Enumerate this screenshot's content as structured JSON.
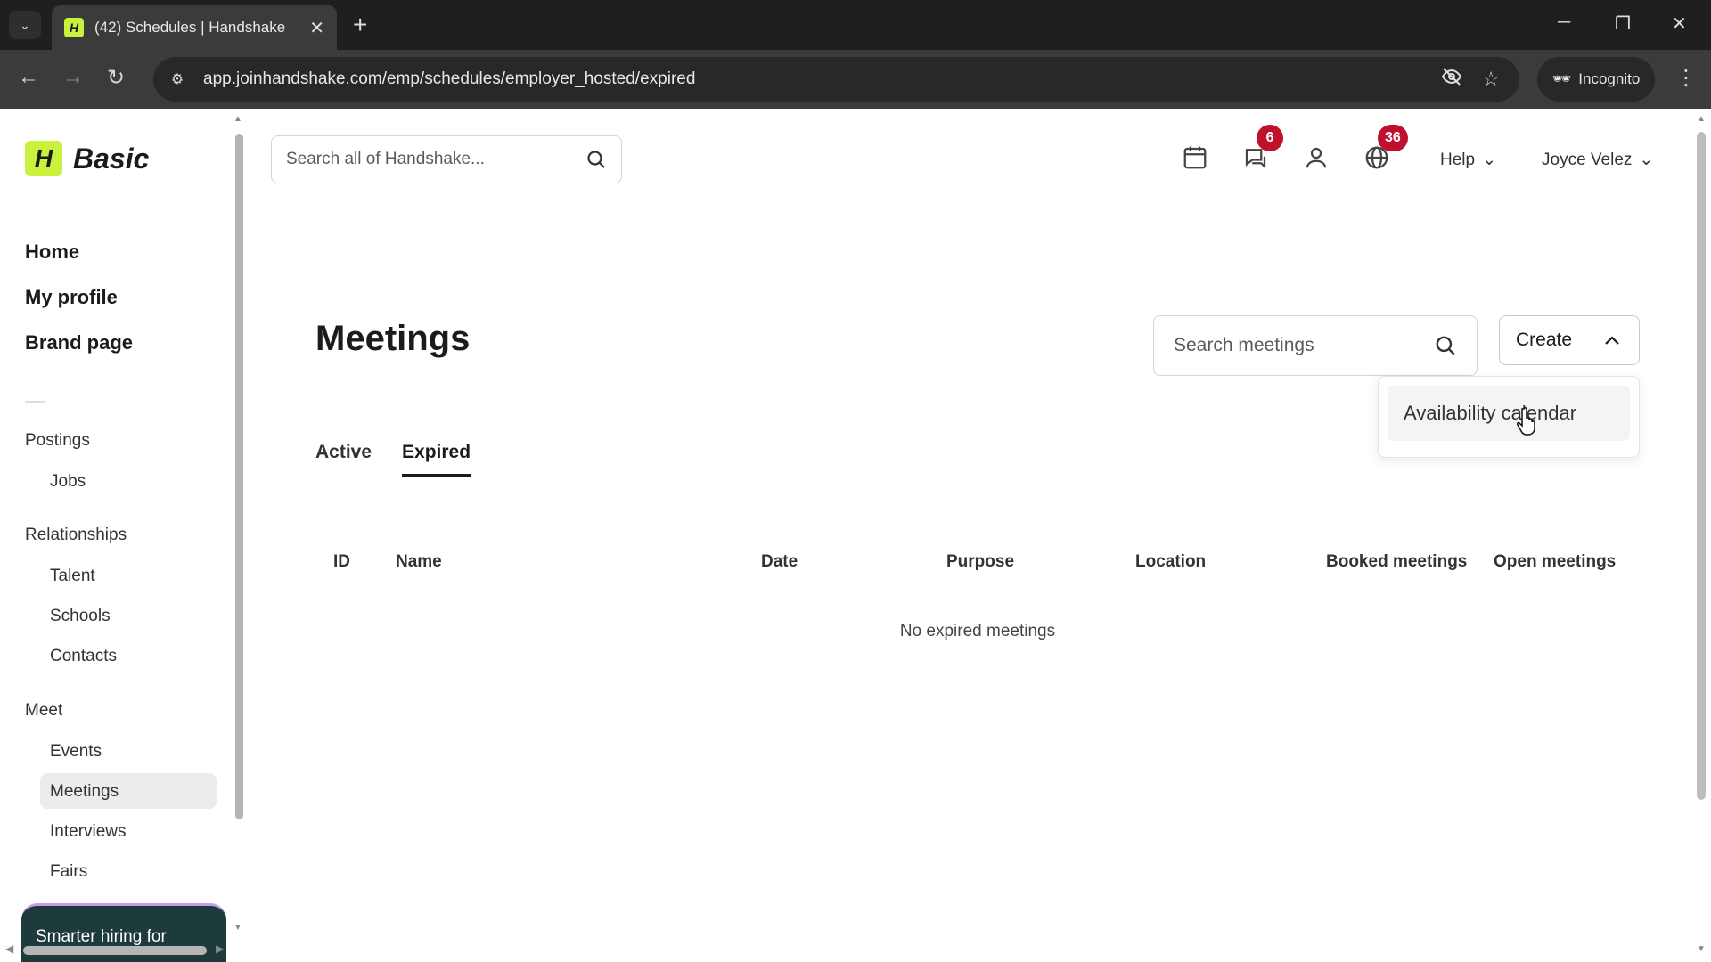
{
  "browser": {
    "tab_title": "(42) Schedules | Handshake",
    "tab_favicon_letter": "H",
    "url": "app.joinhandshake.com/emp/schedules/employer_hosted/expired",
    "incognito_label": "Incognito"
  },
  "logo": {
    "mark": "H",
    "plan": "Basic"
  },
  "primary_nav": [
    {
      "label": "Home"
    },
    {
      "label": "My profile"
    },
    {
      "label": "Brand page"
    }
  ],
  "nav_groups": {
    "postings": {
      "label": "Postings",
      "items": [
        "Jobs"
      ]
    },
    "relationships": {
      "label": "Relationships",
      "items": [
        "Talent",
        "Schools",
        "Contacts"
      ]
    },
    "meet": {
      "label": "Meet",
      "items": [
        "Events",
        "Meetings",
        "Interviews",
        "Fairs"
      ],
      "active": "Meetings"
    }
  },
  "promo": {
    "text": "Smarter hiring for"
  },
  "header": {
    "search_placeholder": "Search all of Handshake...",
    "messages_badge": "6",
    "notifications_badge": "36",
    "help_label": "Help",
    "user_name": "Joyce Velez"
  },
  "page": {
    "title": "Meetings",
    "search_placeholder": "Search meetings",
    "create_label": "Create",
    "dropdown_items": [
      "Availability calendar"
    ],
    "tabs": [
      {
        "label": "Active",
        "active": false
      },
      {
        "label": "Expired",
        "active": true
      }
    ],
    "columns": [
      "ID",
      "Name",
      "Date",
      "Purpose",
      "Location",
      "Booked meetings",
      "Open meetings"
    ],
    "empty_message": "No expired meetings"
  },
  "colors": {
    "brand_accent": "#c9f23e",
    "badge": "#c0102d",
    "promo_bg": "#1d3b3a"
  }
}
